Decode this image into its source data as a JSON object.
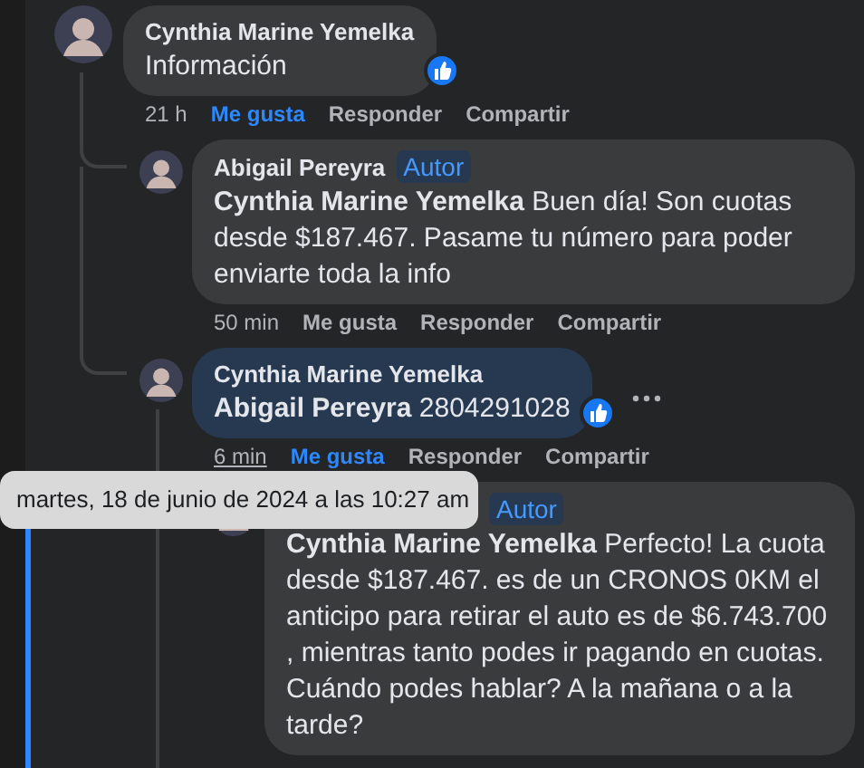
{
  "comments": [
    {
      "author": "Cynthia Marine Yemelka",
      "text": "Información",
      "highlighted": false,
      "liked": true,
      "show_more": false,
      "time": "21 h",
      "time_hovered": false,
      "actions": [
        {
          "label": "Me gusta",
          "selected": true
        },
        {
          "label": "Responder",
          "selected": false
        },
        {
          "label": "Compartir",
          "selected": false
        }
      ],
      "children": [
        {
          "author": "Abigail Pereyra",
          "badge": "Autor",
          "text": "**Cynthia Marine Yemelka** Buen día! Son cuotas desde $187.467. Pasame tu número para poder enviarte toda la info",
          "highlighted": false,
          "liked": false,
          "show_more": false,
          "time": "50 min",
          "time_hovered": false,
          "actions": [
            {
              "label": "Me gusta",
              "selected": false
            },
            {
              "label": "Responder",
              "selected": false
            },
            {
              "label": "Compartir",
              "selected": false
            }
          ]
        },
        {
          "author": "Cynthia Marine Yemelka",
          "text": "**Abigail Pereyra** 2804291028",
          "highlighted": true,
          "liked": true,
          "show_more": true,
          "time": "6 min",
          "time_hovered": true,
          "actions": [
            {
              "label": "Me gusta",
              "selected": true
            },
            {
              "label": "Responder",
              "selected": false
            },
            {
              "label": "Compartir",
              "selected": false
            }
          ],
          "children": [
            {
              "badge": "Autor",
              "text": "**Cynthia Marine Yemelka** Perfecto! La cuota desde $187.467. es de un CRONOS 0KM el anticipo para retirar el auto es de $6.743.700 , mientras tanto podes ir pagando en cuotas. Cuándo podes hablar? A la mañana o a la tarde?",
              "highlighted": false,
              "liked": false,
              "show_more": false
            }
          ]
        }
      ]
    }
  ],
  "tooltip": {
    "text": "martes, 18 de junio de 2024 a las 10:27 am"
  }
}
